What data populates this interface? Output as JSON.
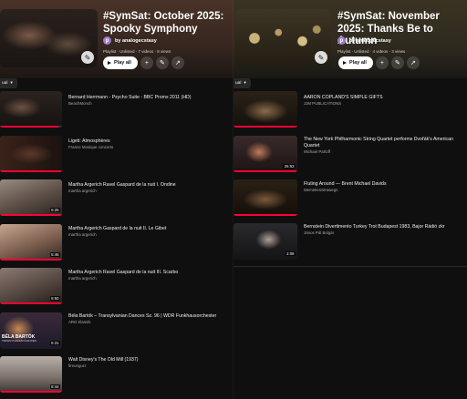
{
  "left": {
    "playlist_title": "#SymSat: October 2025: Spooky Symphony",
    "owner_initial": "p",
    "owner_name": "by analogecstasy",
    "meta": "Playlist · Unlisted · 7 videos · 8 views",
    "play_all_label": "Play all",
    "sort_label": "ual",
    "videos": [
      {
        "title": "Bernard Herrmann - Psycho Suite - BBC Proms 2011 (HD)",
        "channel": "BeachMonch",
        "duration": "",
        "progress": 0.94
      },
      {
        "title": "Ligeti: Atmosphères",
        "channel": "France Musique concerts",
        "duration": "",
        "progress": 1.0
      },
      {
        "title": "Martha Argerich Ravel Gaspard de la nuit I. Ondine",
        "channel": "martha argerich",
        "duration": "6:26",
        "progress": 1.0
      },
      {
        "title": "Martha Argerich Gaspard de la nuit II. Le Gibet",
        "channel": "martha argerich",
        "duration": "5:46",
        "progress": 1.0
      },
      {
        "title": "Martha Argerich Ravel Gaspard de la nuit III. Scarbo",
        "channel": "martha argerich",
        "duration": "8:50",
        "progress": 1.0
      },
      {
        "title": "Béla Bartók – Transylvanian Dances Sz. 96 | WDR Funkhausorchester",
        "channel": "ARD Klassik",
        "duration": "5:31",
        "progress": 0.0,
        "caption": "BÉLA BARTÓK",
        "caption_sub": "TRANSYLVANIAN DANCES"
      },
      {
        "title": "Walt Disney's The Old Mill (1937)",
        "channel": "fireungurz",
        "duration": "8:44",
        "progress": 1.0
      }
    ]
  },
  "right": {
    "playlist_title": "#SymSat: November 2025: Thanks Be to Autumn",
    "owner_initial": "p",
    "owner_name": "by analogecstasy",
    "meta": "Playlist · Unlisted · 4 videos · 3 views",
    "play_all_label": "Play all",
    "sort_label": "ual",
    "videos": [
      {
        "title": "AARON COPLAND'S SIMPLE GIFTS",
        "channel": "JJM PUBLICATIONS",
        "duration": "",
        "progress": 1.0
      },
      {
        "title": "The New York Philharmonic String Quartet performs Dvořák's American Quartet",
        "channel": "Michael Parloff",
        "duration": "26:53",
        "progress": 1.0
      },
      {
        "title": "Fluting Around — Brent Michael Davids",
        "channel": "MemekesStrawegs",
        "duration": "",
        "progress": 1.0
      },
      {
        "title": "Bernstein Divertimento Turkey Trot Budapest 1983, Bajor Rádió zkr",
        "channel": "János Pál Bolgár",
        "duration": "2:08",
        "progress": 0.0
      }
    ]
  },
  "colors": {
    "progress_red": "#ff0033",
    "background": "#0f0f0f",
    "play_button": "#ffffff"
  }
}
